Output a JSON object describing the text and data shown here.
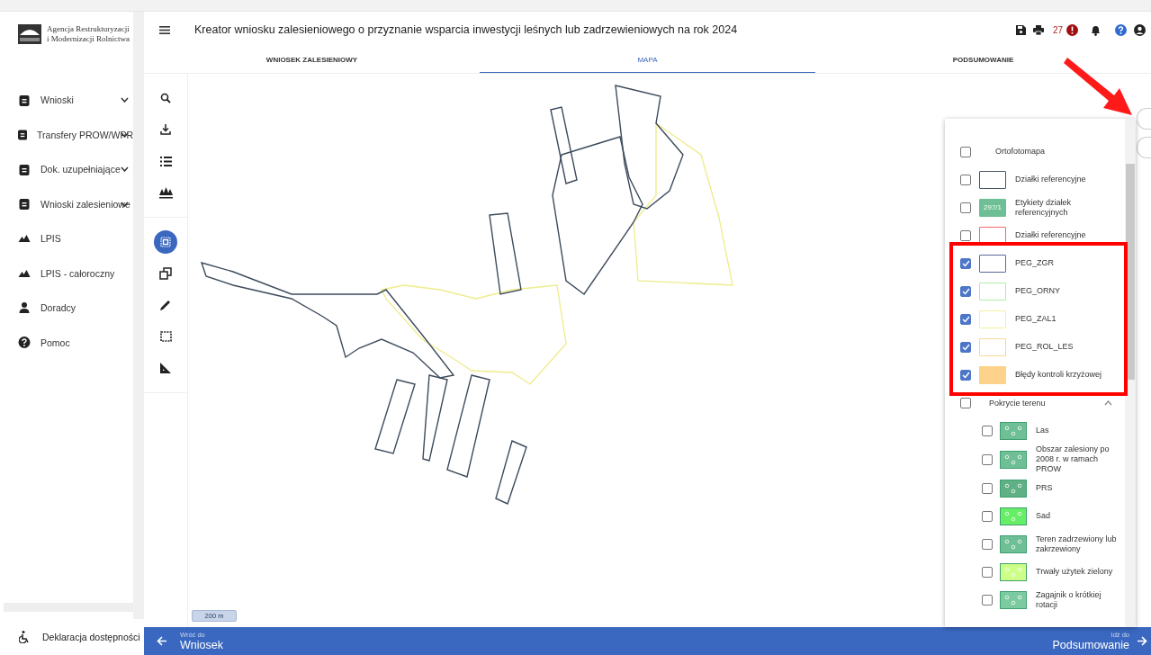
{
  "logo": {
    "line_1": "Agencja Restrukturyzacji",
    "line_2": "i Modernizacji Rolnictwa"
  },
  "sidebar": {
    "items": [
      {
        "label": "Wnioski",
        "kind": "folder"
      },
      {
        "label": "Transfery PROW/WPR",
        "kind": "folder"
      },
      {
        "label": "Dok. uzupełniające",
        "kind": "folder"
      },
      {
        "label": "Wnioski zalesieniowe",
        "kind": "folder"
      },
      {
        "label": "LPIS",
        "kind": "map"
      },
      {
        "label": "LPIS - całoroczny",
        "kind": "map"
      },
      {
        "label": "Doradcy",
        "kind": "person"
      },
      {
        "label": "Pomoc",
        "kind": "help"
      }
    ],
    "footer_link": "Deklaracja dostępności"
  },
  "header": {
    "title": "Kreator wniosku zalesieniowego o przyznanie wsparcia inwestycji leśnych lub zadrzewieniowych na rok 2024",
    "error_count": "27"
  },
  "tabs": [
    {
      "label": "WNIOSEK ZALESIENIOWY",
      "selected": false
    },
    {
      "label": "MAPA",
      "selected": true
    },
    {
      "label": "PODSUMOWANIE",
      "selected": false
    }
  ],
  "tool_groups": [
    [
      {
        "kind": "search",
        "selected": false
      },
      {
        "kind": "download",
        "selected": false
      },
      {
        "kind": "list",
        "selected": false
      },
      {
        "kind": "trees",
        "selected": false
      }
    ],
    [
      {
        "kind": "select",
        "selected": true
      },
      {
        "kind": "copy",
        "selected": false
      },
      {
        "kind": "pencil",
        "selected": false
      },
      {
        "kind": "rectangle",
        "selected": false
      },
      {
        "kind": "ruler",
        "selected": false
      }
    ]
  ],
  "map": {
    "scale": "200 m"
  },
  "layers": [
    {
      "label": "Ortofotomapa",
      "checked": false,
      "kind": "none"
    },
    {
      "label": "Działki referencyjne",
      "checked": false,
      "kind": "outline",
      "color": "#4a5568"
    },
    {
      "label": "Etykiety działek referencyjnych",
      "checked": false,
      "kind": "label",
      "color": "#6fbf96",
      "swatch_text": "297/1"
    },
    {
      "label": "Działki referencyjne",
      "checked": false,
      "kind": "outline",
      "color": "#f06a6a"
    },
    {
      "label": "PEG_ZGR",
      "checked": true,
      "kind": "outline",
      "color": "#5a6a9a"
    },
    {
      "label": "PEG_ORNY",
      "checked": true,
      "kind": "outline",
      "color": "#a8f0a0"
    },
    {
      "label": "PEG_ZAL1",
      "checked": true,
      "kind": "outline",
      "color": "#f4f0a0"
    },
    {
      "label": "PEG_ROL_LES",
      "checked": true,
      "kind": "outline",
      "color": "#f8d890"
    },
    {
      "label": "Błędy kontroli krzyżowej",
      "checked": true,
      "kind": "fill",
      "color": "#fdd28a"
    }
  ],
  "land_cover": {
    "label": "Pokrycie terenu",
    "checked": false,
    "expanded": true,
    "children": [
      {
        "label": "Las",
        "checked": false,
        "color": "#6fbf96"
      },
      {
        "label": "Obszar zalesiony po 2008 r. w ramach PROW",
        "checked": false,
        "color": "#6fbf96"
      },
      {
        "label": "PRS",
        "checked": false,
        "color": "#5fb085"
      },
      {
        "label": "Sad",
        "checked": false,
        "color": "#66ee66"
      },
      {
        "label": "Teren zadrzewiony lub zakrzewiony",
        "checked": false,
        "color": "#6fbf96"
      },
      {
        "label": "Trwały użytek zielony",
        "checked": false,
        "color": "#ccff88"
      },
      {
        "label": "Zagajnik o krótkiej rotacji",
        "checked": false,
        "color": "#7ccaa0"
      }
    ]
  },
  "footer": {
    "back_caption": "Wróć do",
    "back_label": "Wniosek",
    "next_caption": "Idź do",
    "next_label": "Podsumowanie"
  }
}
